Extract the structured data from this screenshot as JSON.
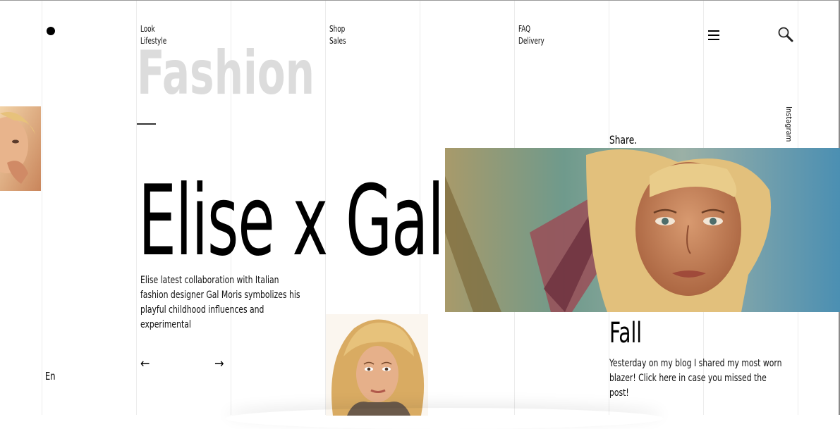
{
  "nav": {
    "col1": [
      "Look",
      "Lifestyle"
    ],
    "col2": [
      "Shop",
      "Sales"
    ],
    "col3": [
      "FAQ",
      "Delivery"
    ]
  },
  "watermark": "Fashion",
  "social": {
    "instagram": "Instagram",
    "share": "Share."
  },
  "hero": {
    "title": "Elise x Gal",
    "description": "Elise latest collaboration with Italian fashion designer Gal Moris symbolizes his playful childhood influences and experimental"
  },
  "arrows": {
    "prev": "←",
    "next": "→"
  },
  "language": "En",
  "post": {
    "title": "Fall",
    "text": "Yesterday on my blog I shared my most worn blazer! Click here in case you missed the post!"
  },
  "icons": [
    "logo-dot-icon",
    "hamburger-menu-icon",
    "search-icon"
  ]
}
